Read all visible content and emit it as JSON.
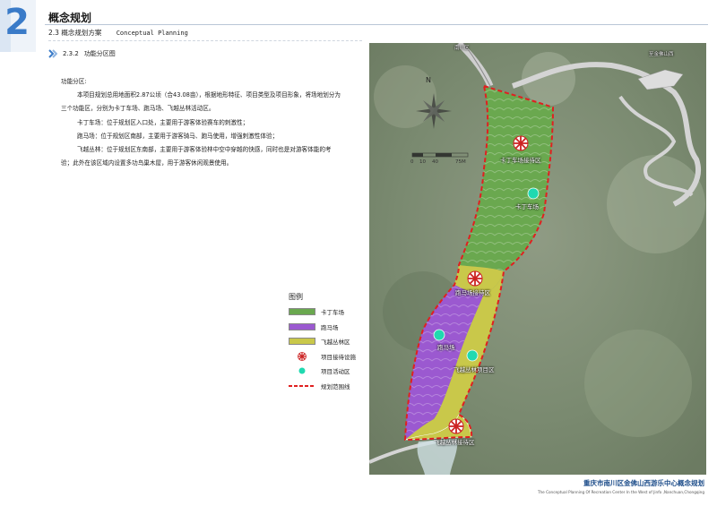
{
  "header": {
    "chapter_number": "2",
    "chapter_title": "概念规划",
    "section_number": "2.3",
    "section_title": "概念规划方案",
    "section_title_en": "Conceptual Planning",
    "subsection_number": "2.3.2",
    "subsection_title": "功能分区图"
  },
  "body": {
    "heading": "功能分区:",
    "paragraph_1": "本项目规划总用地面积2.87公顷（合43.08亩），根据地形特征、项目类型及项目形象，将场地划分为三个功能区，分别为卡丁车场、跑马场、飞越丛林活动区。",
    "paragraph_2": "卡丁车场：位于规划区入口处，主要用于游客体验赛车的刺激性；",
    "paragraph_3": "跑马场：位于规划区南部，主要用于游客骑马、跑马使用，增强刺激性体验；",
    "paragraph_4": "飞越丛林：位于规划区东南部，主要用于游客体验林中空中穿越的快感，同时也是对游客体能的考验；此外在该区域内设置多功鸟巢木屋，用于游客休闲观景使用。"
  },
  "legend": {
    "title": "图例",
    "items": [
      {
        "label": "卡丁车场",
        "kind": "fill",
        "color": "#6aa84f"
      },
      {
        "label": "跑马场",
        "kind": "fill",
        "color": "#9b59d0"
      },
      {
        "label": "飞越丛林区",
        "kind": "fill",
        "color": "#c9c84a"
      },
      {
        "label": "项目接待设施",
        "kind": "reception-icon",
        "color": "#cc2222"
      },
      {
        "label": "项目活动区",
        "kind": "activity-icon",
        "color": "#20d9b0"
      },
      {
        "label": "规划范围线",
        "kind": "boundary-line",
        "color": "#e02020"
      }
    ]
  },
  "map": {
    "compass_label": "N",
    "scale_ticks": [
      "0",
      "10",
      "40",
      "75M"
    ],
    "road_labels": [
      "南川区",
      "至金佛山西"
    ],
    "labels": {
      "kart_reception": "卡丁车场接待区",
      "kart_track": "卡丁车场",
      "horse_reception": "跑马场接待区",
      "horse_track": "跑马场",
      "jungle_project": "飞越丛林项目区",
      "jungle_reception": "飞越丛林接待区"
    }
  },
  "footer": {
    "title_cn": "重庆市南川区金佛山西游乐中心概念规划",
    "title_en": "The Conceptual Planning Of Recreation Center In the West of Jinfo ,Nanchuan,Chongqing"
  },
  "colors": {
    "accent_blue": "#3a7bc8",
    "kart_zone": "#6aa84f",
    "horse_zone": "#9b59d0",
    "jungle_zone": "#c9c84a",
    "boundary": "#e02020"
  }
}
